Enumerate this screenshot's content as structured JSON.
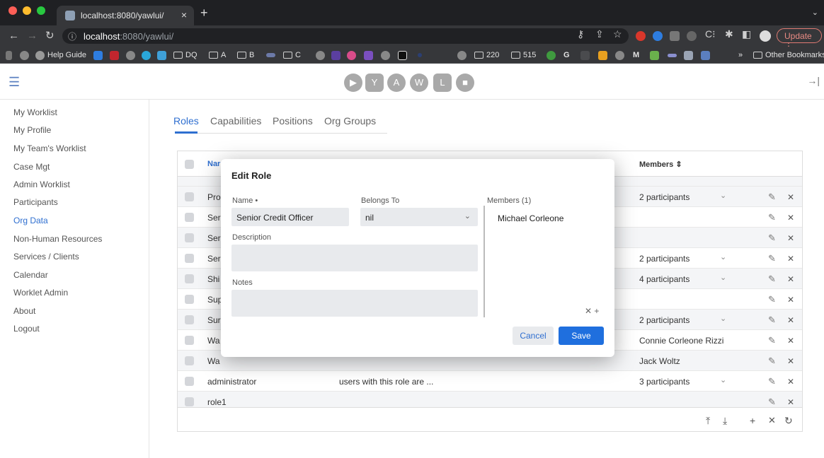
{
  "browser": {
    "tab_title": "localhost:8080/yawlui/",
    "url_host": "localhost",
    "url_rest": ":8080/yawlui/",
    "update_label": "Update",
    "bookmarks": [
      {
        "label": "Help Guide",
        "color": "#8c8c8c"
      },
      {
        "label": "DQ",
        "color": "folder"
      },
      {
        "label": "A",
        "color": "folder"
      },
      {
        "label": "B",
        "color": "folder"
      },
      {
        "label": "C",
        "color": "folder"
      },
      {
        "label": "220",
        "color": "folder"
      },
      {
        "label": "515",
        "color": "folder"
      },
      {
        "label": "G",
        "color": "#222"
      },
      {
        "label": "M",
        "color": "#222"
      }
    ],
    "other_bookmarks": "Other Bookmarks",
    "overflow": "»"
  },
  "sidebar": {
    "items": [
      {
        "label": "My Worklist"
      },
      {
        "label": "My Profile"
      },
      {
        "label": "My Team's Worklist"
      },
      {
        "label": "Case Mgt"
      },
      {
        "label": "Admin Worklist"
      },
      {
        "label": "Participants"
      },
      {
        "label": "Org Data"
      },
      {
        "label": "Non-Human Resources"
      },
      {
        "label": "Services / Clients"
      },
      {
        "label": "Calendar"
      },
      {
        "label": "Worklet Admin"
      },
      {
        "label": "About"
      },
      {
        "label": "Logout"
      }
    ],
    "active": "Org Data"
  },
  "tabs": [
    "Roles",
    "Capabilities",
    "Positions",
    "Org Groups"
  ],
  "table": {
    "header_name": "Nar",
    "header_members": "Members ⇕",
    "rows": [
      {
        "name": "Pro",
        "desc": "",
        "members": "2 participants",
        "dd": true
      },
      {
        "name": "Ser",
        "desc": "",
        "members": "",
        "dd": false
      },
      {
        "name": "Ser",
        "desc": "",
        "members": "",
        "dd": false
      },
      {
        "name": "Ser",
        "desc": "",
        "members": "2 participants",
        "dd": true
      },
      {
        "name": "Shi",
        "desc": "",
        "members": "4 participants",
        "dd": true
      },
      {
        "name": "Sup",
        "desc": "",
        "members": "",
        "dd": false
      },
      {
        "name": "Sur",
        "desc": "",
        "members": "2 participants",
        "dd": true
      },
      {
        "name": "Wa",
        "desc": "",
        "members": "Connie Corleone Rizzi",
        "dd": false
      },
      {
        "name": "Wa",
        "desc": "",
        "members": "Jack Woltz",
        "dd": false
      },
      {
        "name": "administrator",
        "desc": "users with this role are ...",
        "members": "3 participants",
        "dd": true
      },
      {
        "name": "role1",
        "desc": "",
        "members": "",
        "dd": false
      }
    ]
  },
  "dialog": {
    "title": "Edit Role",
    "name_label": "Name",
    "required_mark": "•",
    "name_value": "Senior Credit Officer",
    "belongs_label": "Belongs To",
    "belongs_value": "nil",
    "description_label": "Description",
    "notes_label": "Notes",
    "members_label": "Members (1)",
    "members": [
      "Michael Corleone"
    ],
    "cancel": "Cancel",
    "save": "Save"
  },
  "colors": {
    "accent": "#2f6fd0",
    "save": "#1f6fde"
  }
}
